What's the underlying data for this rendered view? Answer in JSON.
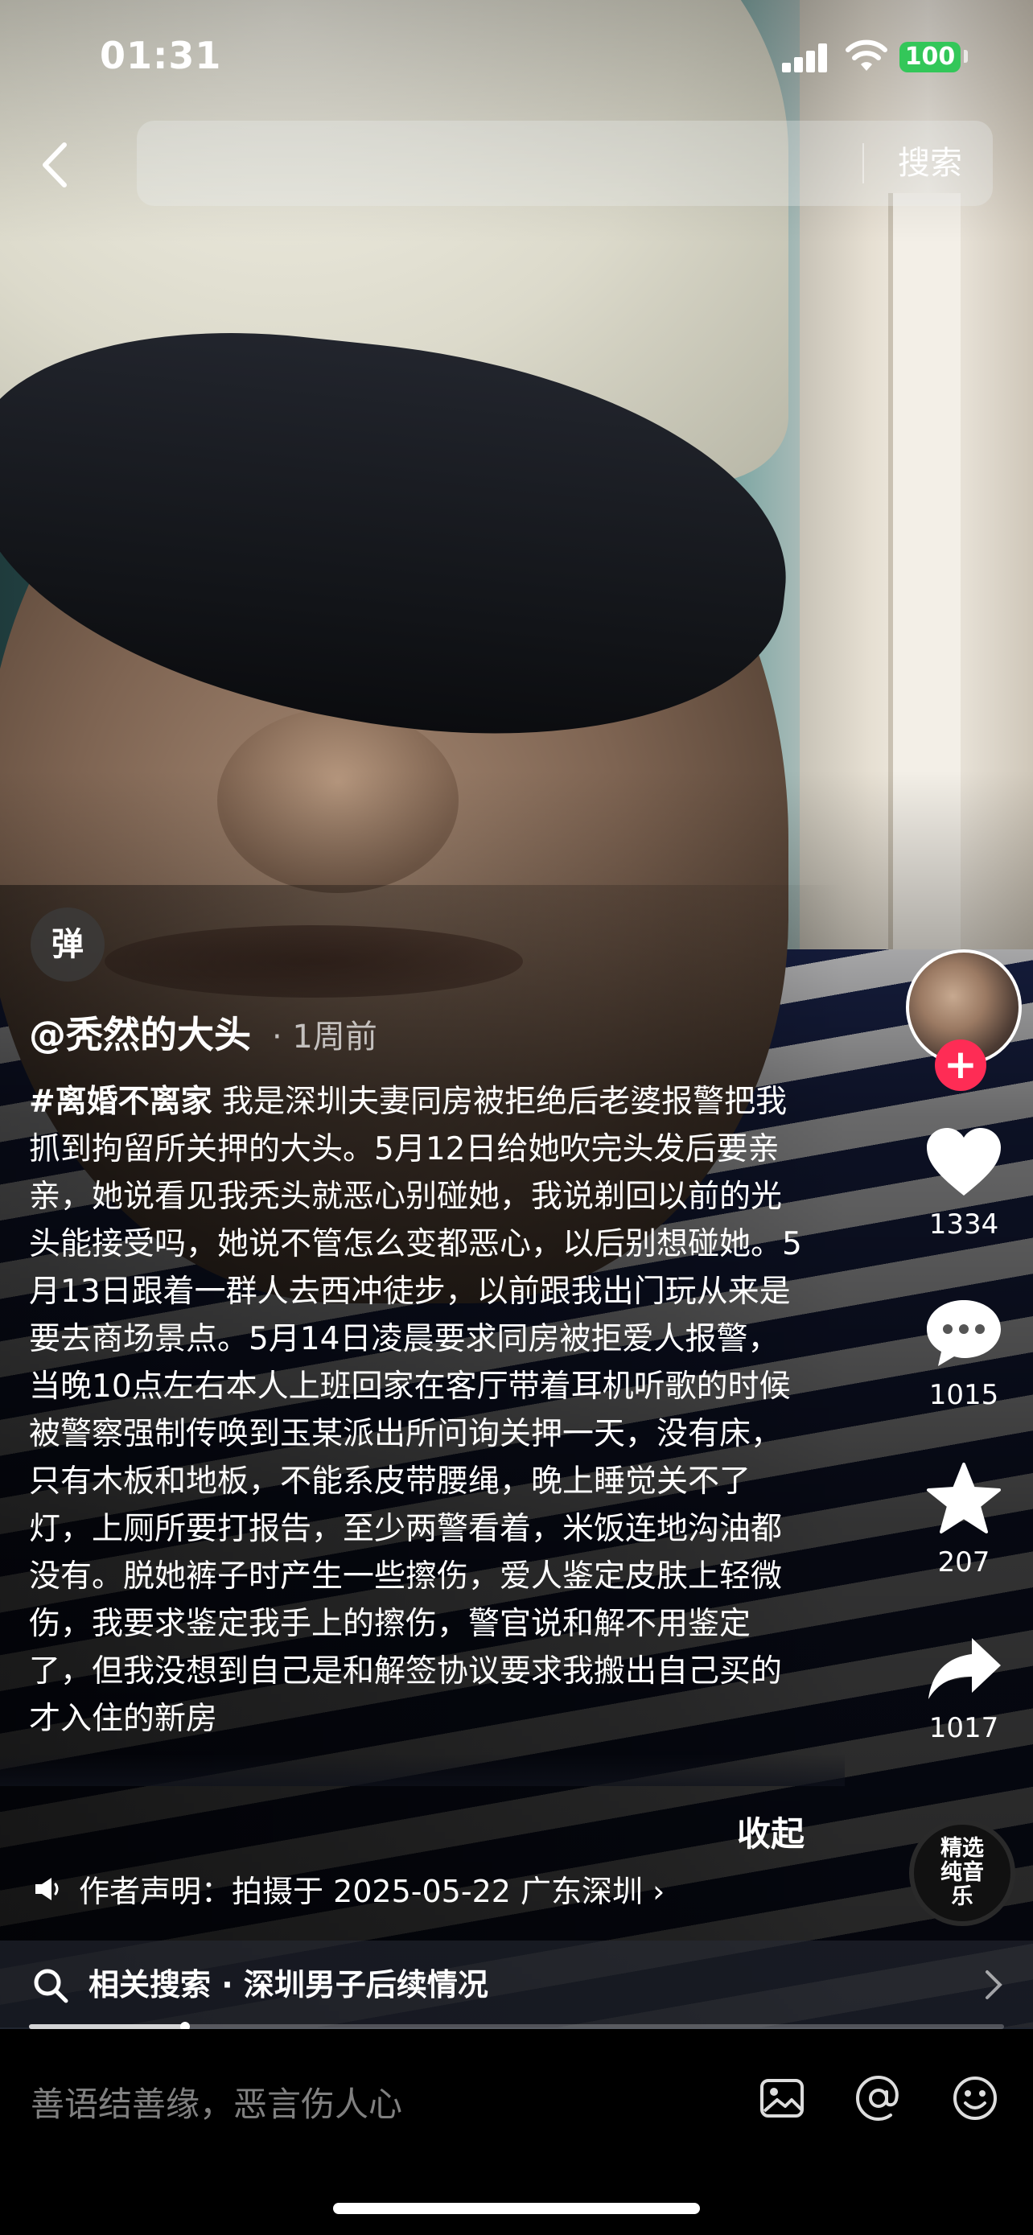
{
  "status_bar": {
    "time": "01:31",
    "battery": "100"
  },
  "top_bar": {
    "search_placeholder": "",
    "search_button": "搜索"
  },
  "danmaku_button": "弹",
  "post": {
    "author": "@秃然的大头",
    "time_ago": "· 1周前",
    "hashtag": "#离婚不离家",
    "caption": " 我是深圳夫妻同房被拒绝后老婆报警把我抓到拘留所关押的大头。5月12日给她吹完头发后要亲亲，她说看见我秃头就恶心别碰她，我说剃回以前的光头能接受吗，她说不管怎么变都恶心，以后别想碰她。5月13日跟着一群人去西冲徒步，以前跟我出门玩从来是要去商场景点。5月14日凌晨要求同房被拒爱人报警，当晚10点左右本人上班回家在客厅带着耳机听歌的时候被警察强制传唤到玉某派出所问询关押一天，没有床，只有木板和地板，不能系皮带腰绳，晚上睡觉关不了灯，上厕所要打报告，至少两警看着，米饭连地沟油都没有。脱她裤子时产生一些擦伤，爱人鉴定皮肤上轻微伤，我要求鉴定我手上的擦伤，警官说和解不用鉴定了，但我没想到自己是和解签协议要求我搬出自己买的才入住的新房",
    "collapse_label": "收起",
    "author_statement": "作者声明：拍摄于 2025-05-22 广东深圳 ›"
  },
  "actions": {
    "follow": "+",
    "likes": "1334",
    "comments": "1015",
    "favorites": "207",
    "shares": "1017",
    "music_label": "精选纯音乐"
  },
  "related_search": {
    "label": "相关搜索 · 深圳男子后续情况"
  },
  "progress": {
    "fraction": 0.16
  },
  "comment_bar": {
    "placeholder": "善语结善缘，恶言伤人心"
  },
  "colors": {
    "follow": "#fe2c55",
    "battery": "#33c759"
  },
  "icons": [
    "back-icon",
    "search-icon",
    "heart-icon",
    "comment-icon",
    "star-icon",
    "share-icon",
    "speaker-icon",
    "chevron-right-icon",
    "image-icon",
    "at-icon",
    "emoji-icon"
  ]
}
